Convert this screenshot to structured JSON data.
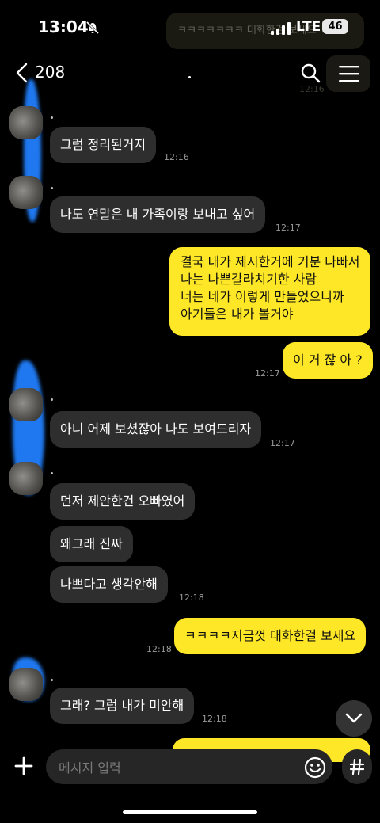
{
  "status": {
    "time": "13:04",
    "network": "LTE",
    "battery": "46"
  },
  "notification_ghost": "ㅋㅋㅋㅋㅋㅋㅋ 대화한걸 보세요",
  "header": {
    "title": "208"
  },
  "messages": [
    {
      "side": "them",
      "text": "그럼 정리된거지",
      "time": "12:16"
    },
    {
      "side": "them",
      "text": "나도 연말은 내 가족이랑 보내고 싶어",
      "time": "12:17"
    },
    {
      "side": "me",
      "lines": [
        "결국 내가 제시한거에 기분 나빠서",
        "나는 나쁜갈라치기한 사람",
        "너는 네가 이렇게 만들었으니까",
        "아기들은 내가 볼거야"
      ],
      "time": ""
    },
    {
      "side": "me",
      "text": "이 거 잖 아 ?",
      "time": "12:17"
    },
    {
      "side": "them",
      "text": "아니 어제 보셨잖아 나도 보여드리자",
      "time": "12:17"
    },
    {
      "side": "them",
      "text": "먼저 제안한건 오빠였어",
      "time": ""
    },
    {
      "side": "them",
      "text": "왜그래 진짜",
      "time": ""
    },
    {
      "side": "them",
      "text": "나쁘다고 생각안해",
      "time": "12:18"
    },
    {
      "side": "me",
      "text": "ㅋㅋㅋㅋ지금껏 대화한걸 보세요",
      "time": "12:18"
    },
    {
      "side": "them",
      "text": "그래? 그럼 내가 미안해",
      "time": "12:18"
    }
  ],
  "input": {
    "placeholder": "메시지 입력",
    "value": ""
  },
  "icons": {
    "back": "chevron-left-icon",
    "search": "search-icon",
    "menu": "hamburger-icon",
    "scroll": "chevron-down-icon",
    "attach": "plus-icon",
    "emoji": "emoji-icon",
    "hashtag": "hashtag-icon"
  },
  "colors": {
    "my_bubble": "#fde726",
    "their_bubble": "#2e2e2e",
    "background": "#000000"
  }
}
